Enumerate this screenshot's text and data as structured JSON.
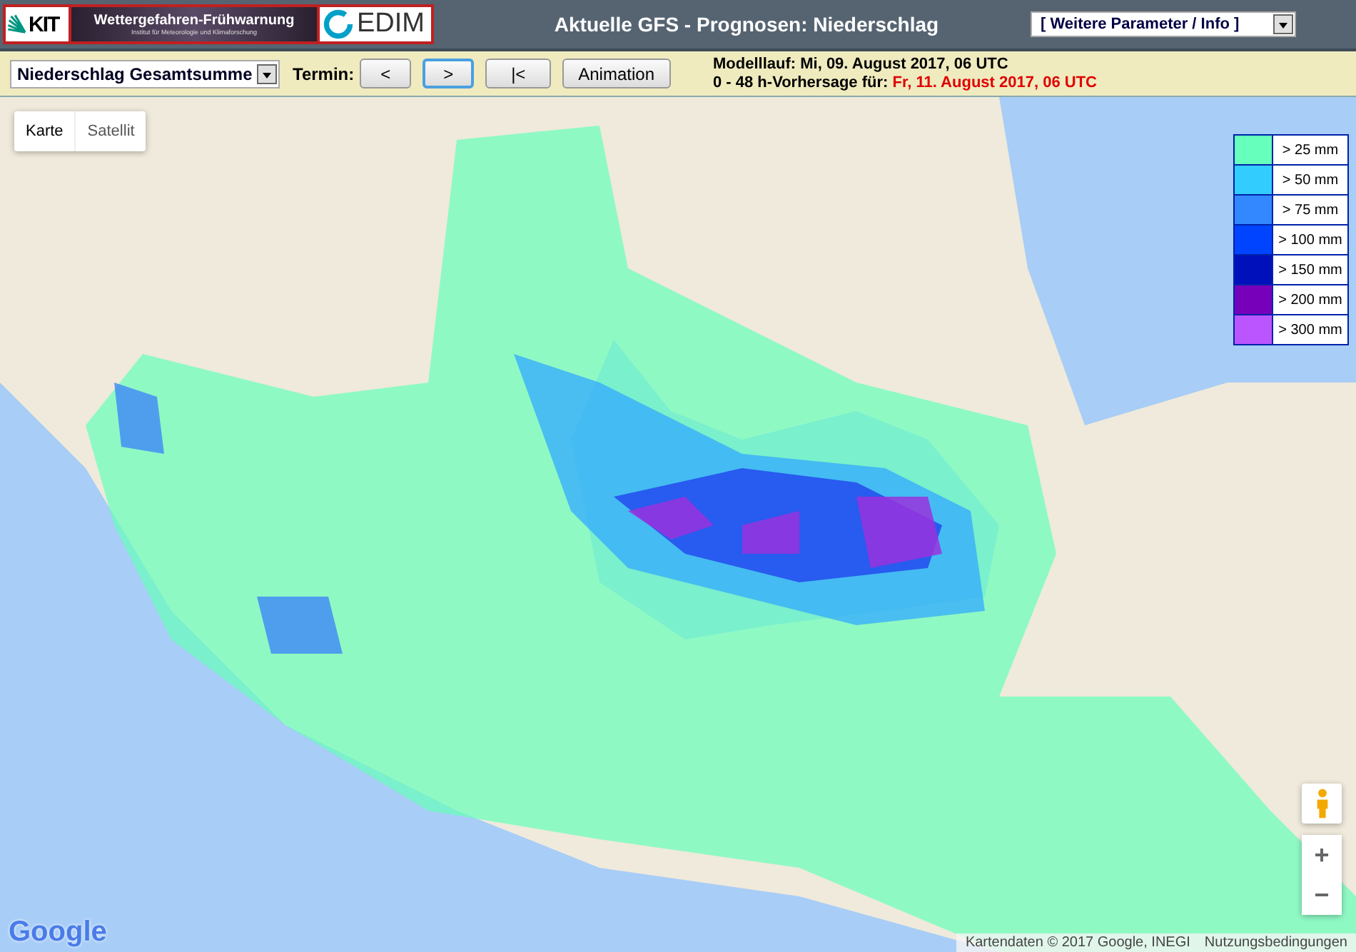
{
  "header": {
    "logos": [
      {
        "kind": "kit",
        "text": "KIT"
      },
      {
        "kind": "banner",
        "text": "Wettergefahren-Frühwarnung",
        "subtitle": "Institut für Meteorologie und Klimaforschung"
      },
      {
        "kind": "cedim",
        "text": "EDIM"
      }
    ],
    "title": "Aktuelle GFS - Prognosen: Niederschlag",
    "menu": {
      "value": "[ Weitere Parameter / Info ]"
    }
  },
  "toolbar": {
    "parameter": {
      "value": "Niederschlag Gesamtsumme"
    },
    "termin_label": "Termin:",
    "buttons": [
      {
        "label": "<",
        "selected": false
      },
      {
        "label": ">",
        "selected": true
      },
      {
        "label": "|<",
        "selected": false
      },
      {
        "label": "Animation",
        "selected": false
      }
    ],
    "model_run": {
      "label": "Modelllauf:",
      "value": "Mi, 09. August 2017, 06 UTC"
    },
    "forecast": {
      "label": "0 - 48 h-Vorhersage für:",
      "value": "Fr, 11. August 2017, 06 UTC"
    }
  },
  "map": {
    "map_types": [
      {
        "label": "Karte",
        "selected": true
      },
      {
        "label": "Satellit",
        "selected": false
      }
    ],
    "legend": [
      {
        "label": "> 25 mm",
        "color": "#66ffbb"
      },
      {
        "label": "> 50 mm",
        "color": "#33ccff"
      },
      {
        "label": "> 75 mm",
        "color": "#3388ff"
      },
      {
        "label": "> 100 mm",
        "color": "#0044ff"
      },
      {
        "label": "> 150 mm",
        "color": "#0011bb"
      },
      {
        "label": "> 200 mm",
        "color": "#7700bb"
      },
      {
        "label": "> 300 mm",
        "color": "#bb55ff"
      }
    ],
    "zoom": [
      "+",
      "−"
    ],
    "google_logo": "Google",
    "attribution": "Kartendaten © 2017 Google, INEGI",
    "terms": "Nutzungsbedingungen"
  }
}
